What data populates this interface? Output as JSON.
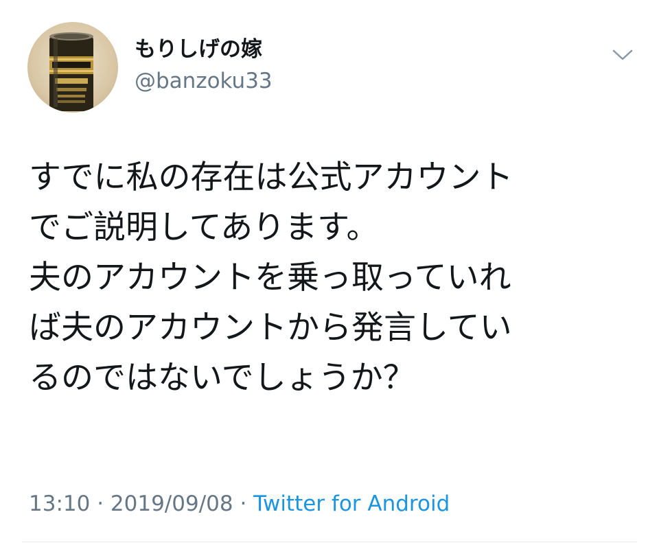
{
  "author": {
    "display_name": "もりしげの嫁",
    "handle": "@banzoku33",
    "avatar": "beer-can-avatar"
  },
  "menu_icon": "chevron-down-icon",
  "tweet": {
    "lines": [
      "すでに私の存在は公式アカウント",
      "でご説明してあります。",
      "夫のアカウントを乗っ取っていれ",
      "ば夫のアカウントから発言してい",
      "るのではないでしょうか？"
    ]
  },
  "meta": {
    "time": "13:10",
    "separator": " · ",
    "date": "2019/09/08",
    "source": "Twitter for Android"
  },
  "colors": {
    "text": "#14171a",
    "secondary": "#657786",
    "link": "#1b95e0",
    "divider": "#e6ecf0"
  }
}
